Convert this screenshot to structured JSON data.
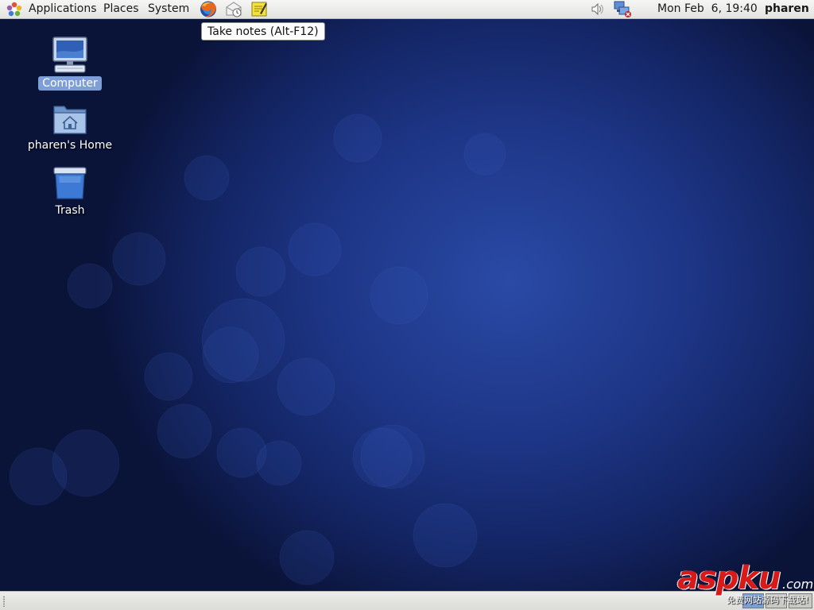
{
  "top_panel": {
    "menus": [
      {
        "label": "Applications"
      },
      {
        "label": "Places"
      },
      {
        "label": "System"
      }
    ],
    "launchers": [
      {
        "icon": "firefox-icon"
      },
      {
        "icon": "mail-clock-icon"
      },
      {
        "icon": "notes-icon"
      }
    ],
    "tray": [
      {
        "icon": "volume-icon"
      },
      {
        "icon": "network-disconnected-icon"
      }
    ],
    "clock": "Mon Feb  6, 19:40",
    "username": "pharen"
  },
  "tooltip": {
    "text": "Take notes (Alt-F12)"
  },
  "desktop": {
    "icons": [
      {
        "label": "Computer",
        "icon": "computer-icon",
        "selected": true
      },
      {
        "label": "pharen's Home",
        "icon": "home-folder-icon",
        "selected": false
      },
      {
        "label": "Trash",
        "icon": "trash-icon",
        "selected": false
      }
    ]
  },
  "watermark": {
    "main": "aspku",
    "suffix": ".com",
    "subtitle": "免费网站源码下载站!"
  },
  "colors": {
    "panel": "#e9e9e6",
    "desktop_center": "#2a4aa6",
    "desktop_edge": "#0a1338",
    "selection": "#7d9ed6",
    "watermark_red": "#d71a1a"
  }
}
